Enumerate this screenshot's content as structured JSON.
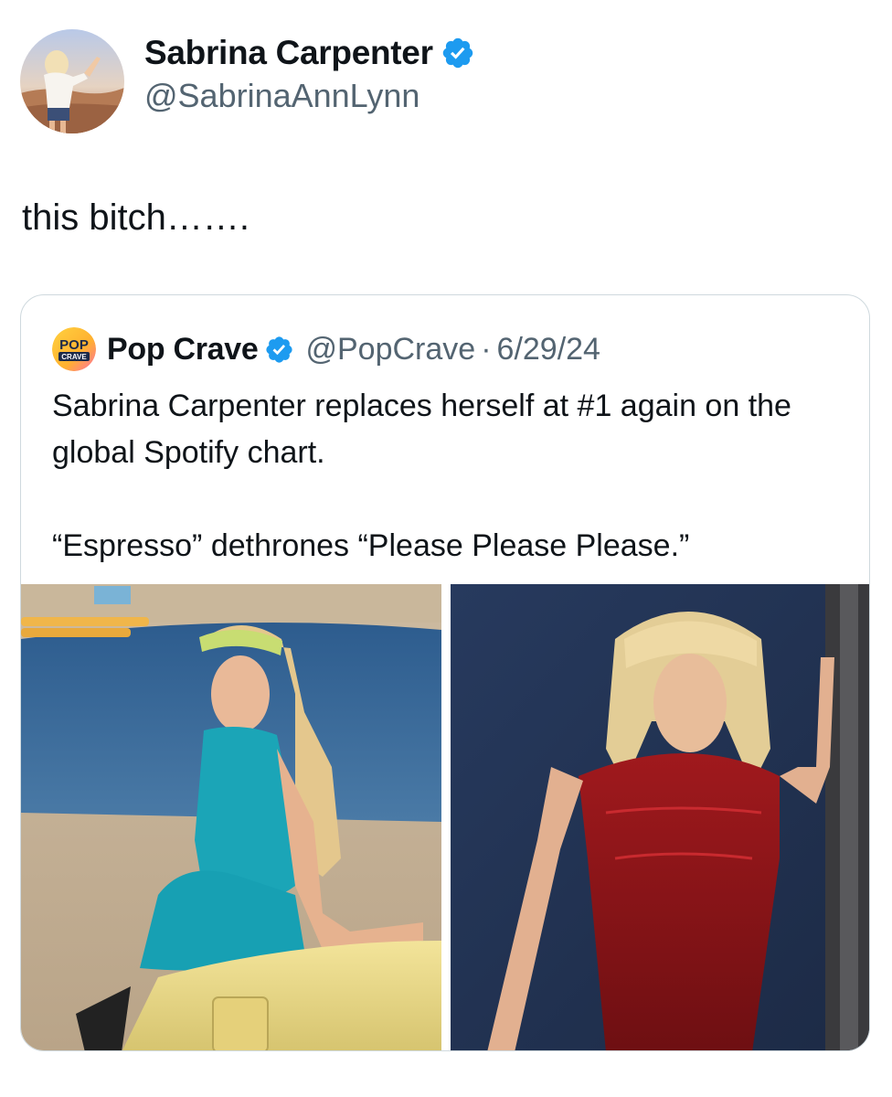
{
  "author": {
    "display_name": "Sabrina Carpenter",
    "handle": "@SabrinaAnnLynn",
    "verified_icon": "verified-badge-icon",
    "accent_color": "#1d9bf0"
  },
  "tweet": {
    "text": "this bitch……."
  },
  "quoted_tweet": {
    "display_name": "Pop Crave",
    "handle": "@PopCrave",
    "separator": "·",
    "date": "6/29/24",
    "logo_text_top": "POP",
    "logo_text_bottom": "CRAVE",
    "text_line1": "Sabrina Carpenter replaces herself at #1 again on the global Spotify chart.",
    "text_line2": "“Espresso” dethrones “Please Please Please.”",
    "media": [
      {
        "icon": "photo-beach-icon"
      },
      {
        "icon": "photo-red-dress-icon"
      }
    ]
  }
}
